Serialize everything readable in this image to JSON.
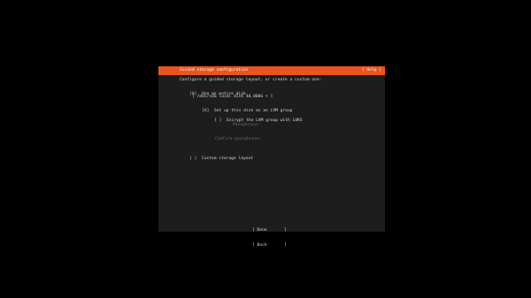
{
  "header": {
    "title": "Guided storage configuration",
    "help_label": "[ Help ]"
  },
  "intro_text": "Configure a guided storage layout, or create a custom one:",
  "options": {
    "entire_disk": {
      "marker": "(X)",
      "label": "Use an entire disk"
    },
    "disk_select": {
      "value": "[ /dev/sda local disk 40.000G ▾ ]"
    },
    "lvm": {
      "marker": "[X]",
      "label": "Set up this disk as an LVM group"
    },
    "luks": {
      "marker": "[ ]",
      "label": "Encrypt the LVM group with LUKS"
    },
    "passphrase": {
      "label": "Passphrase:"
    },
    "confirm_passphrase": {
      "label": "Confirm passphrase:"
    },
    "custom": {
      "marker": "( )",
      "label": "Custom storage layout"
    }
  },
  "buttons": {
    "done": "[ Done       ]",
    "back": "[ Back       ]"
  },
  "colors": {
    "accent": "#e95420",
    "panel": "#1d1d1d",
    "background": "#000000"
  }
}
